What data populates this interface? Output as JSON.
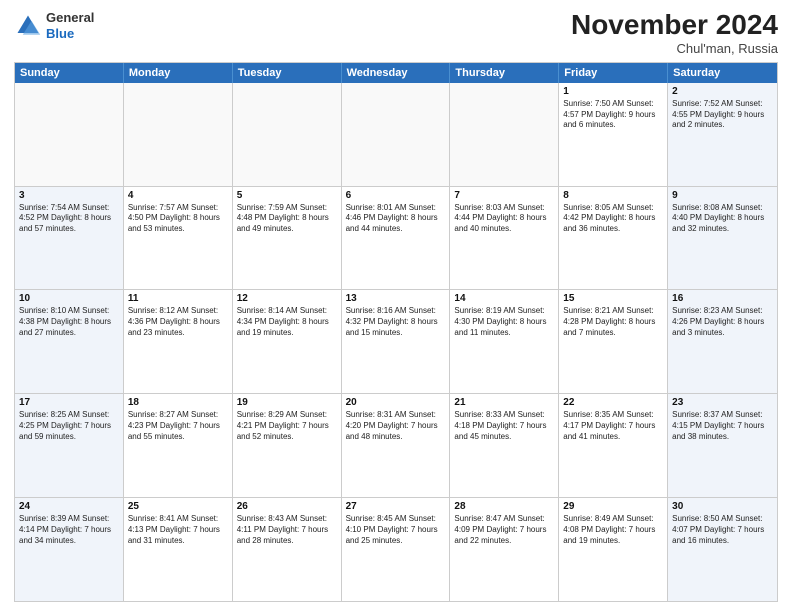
{
  "logo": {
    "general": "General",
    "blue": "Blue"
  },
  "title": "November 2024",
  "location": "Chul'man, Russia",
  "days_of_week": [
    "Sunday",
    "Monday",
    "Tuesday",
    "Wednesday",
    "Thursday",
    "Friday",
    "Saturday"
  ],
  "weeks": [
    [
      {
        "day": "",
        "info": ""
      },
      {
        "day": "",
        "info": ""
      },
      {
        "day": "",
        "info": ""
      },
      {
        "day": "",
        "info": ""
      },
      {
        "day": "",
        "info": ""
      },
      {
        "day": "1",
        "info": "Sunrise: 7:50 AM\nSunset: 4:57 PM\nDaylight: 9 hours\nand 6 minutes."
      },
      {
        "day": "2",
        "info": "Sunrise: 7:52 AM\nSunset: 4:55 PM\nDaylight: 9 hours\nand 2 minutes."
      }
    ],
    [
      {
        "day": "3",
        "info": "Sunrise: 7:54 AM\nSunset: 4:52 PM\nDaylight: 8 hours\nand 57 minutes."
      },
      {
        "day": "4",
        "info": "Sunrise: 7:57 AM\nSunset: 4:50 PM\nDaylight: 8 hours\nand 53 minutes."
      },
      {
        "day": "5",
        "info": "Sunrise: 7:59 AM\nSunset: 4:48 PM\nDaylight: 8 hours\nand 49 minutes."
      },
      {
        "day": "6",
        "info": "Sunrise: 8:01 AM\nSunset: 4:46 PM\nDaylight: 8 hours\nand 44 minutes."
      },
      {
        "day": "7",
        "info": "Sunrise: 8:03 AM\nSunset: 4:44 PM\nDaylight: 8 hours\nand 40 minutes."
      },
      {
        "day": "8",
        "info": "Sunrise: 8:05 AM\nSunset: 4:42 PM\nDaylight: 8 hours\nand 36 minutes."
      },
      {
        "day": "9",
        "info": "Sunrise: 8:08 AM\nSunset: 4:40 PM\nDaylight: 8 hours\nand 32 minutes."
      }
    ],
    [
      {
        "day": "10",
        "info": "Sunrise: 8:10 AM\nSunset: 4:38 PM\nDaylight: 8 hours\nand 27 minutes."
      },
      {
        "day": "11",
        "info": "Sunrise: 8:12 AM\nSunset: 4:36 PM\nDaylight: 8 hours\nand 23 minutes."
      },
      {
        "day": "12",
        "info": "Sunrise: 8:14 AM\nSunset: 4:34 PM\nDaylight: 8 hours\nand 19 minutes."
      },
      {
        "day": "13",
        "info": "Sunrise: 8:16 AM\nSunset: 4:32 PM\nDaylight: 8 hours\nand 15 minutes."
      },
      {
        "day": "14",
        "info": "Sunrise: 8:19 AM\nSunset: 4:30 PM\nDaylight: 8 hours\nand 11 minutes."
      },
      {
        "day": "15",
        "info": "Sunrise: 8:21 AM\nSunset: 4:28 PM\nDaylight: 8 hours\nand 7 minutes."
      },
      {
        "day": "16",
        "info": "Sunrise: 8:23 AM\nSunset: 4:26 PM\nDaylight: 8 hours\nand 3 minutes."
      }
    ],
    [
      {
        "day": "17",
        "info": "Sunrise: 8:25 AM\nSunset: 4:25 PM\nDaylight: 7 hours\nand 59 minutes."
      },
      {
        "day": "18",
        "info": "Sunrise: 8:27 AM\nSunset: 4:23 PM\nDaylight: 7 hours\nand 55 minutes."
      },
      {
        "day": "19",
        "info": "Sunrise: 8:29 AM\nSunset: 4:21 PM\nDaylight: 7 hours\nand 52 minutes."
      },
      {
        "day": "20",
        "info": "Sunrise: 8:31 AM\nSunset: 4:20 PM\nDaylight: 7 hours\nand 48 minutes."
      },
      {
        "day": "21",
        "info": "Sunrise: 8:33 AM\nSunset: 4:18 PM\nDaylight: 7 hours\nand 45 minutes."
      },
      {
        "day": "22",
        "info": "Sunrise: 8:35 AM\nSunset: 4:17 PM\nDaylight: 7 hours\nand 41 minutes."
      },
      {
        "day": "23",
        "info": "Sunrise: 8:37 AM\nSunset: 4:15 PM\nDaylight: 7 hours\nand 38 minutes."
      }
    ],
    [
      {
        "day": "24",
        "info": "Sunrise: 8:39 AM\nSunset: 4:14 PM\nDaylight: 7 hours\nand 34 minutes."
      },
      {
        "day": "25",
        "info": "Sunrise: 8:41 AM\nSunset: 4:13 PM\nDaylight: 7 hours\nand 31 minutes."
      },
      {
        "day": "26",
        "info": "Sunrise: 8:43 AM\nSunset: 4:11 PM\nDaylight: 7 hours\nand 28 minutes."
      },
      {
        "day": "27",
        "info": "Sunrise: 8:45 AM\nSunset: 4:10 PM\nDaylight: 7 hours\nand 25 minutes."
      },
      {
        "day": "28",
        "info": "Sunrise: 8:47 AM\nSunset: 4:09 PM\nDaylight: 7 hours\nand 22 minutes."
      },
      {
        "day": "29",
        "info": "Sunrise: 8:49 AM\nSunset: 4:08 PM\nDaylight: 7 hours\nand 19 minutes."
      },
      {
        "day": "30",
        "info": "Sunrise: 8:50 AM\nSunset: 4:07 PM\nDaylight: 7 hours\nand 16 minutes."
      }
    ]
  ]
}
